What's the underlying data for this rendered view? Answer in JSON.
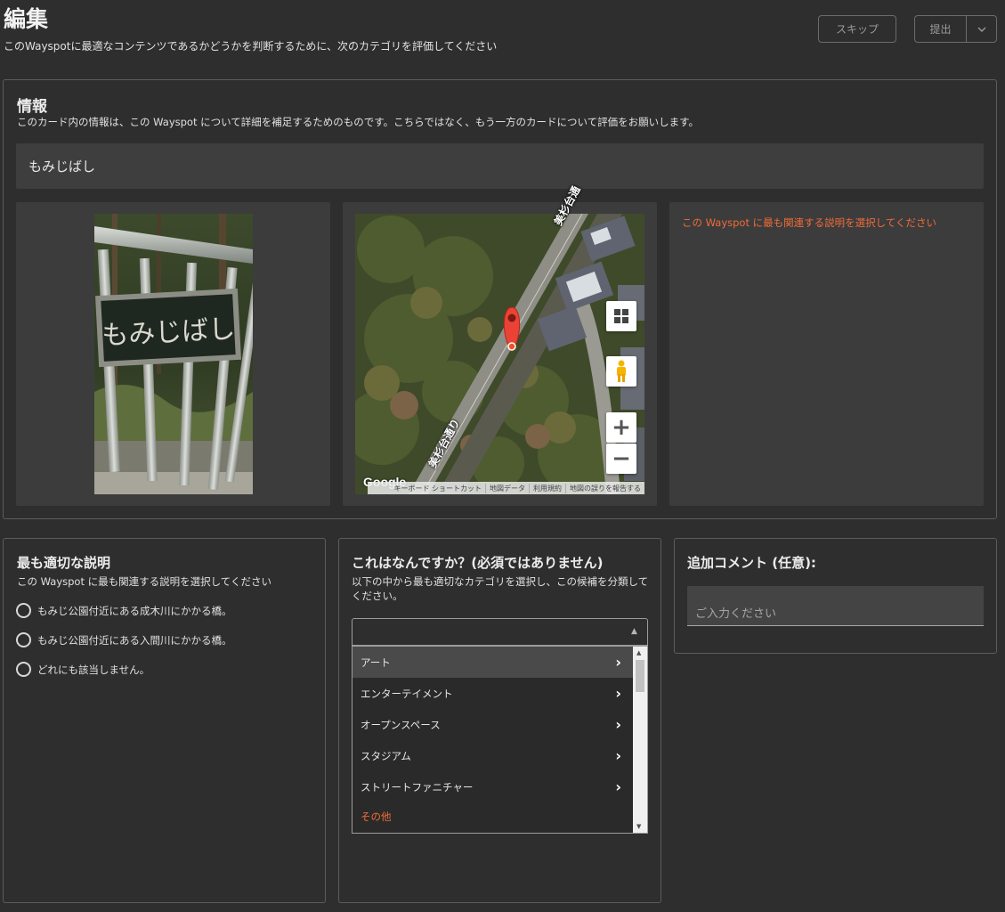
{
  "header": {
    "title": "編集",
    "subtitle": "このWayspotに最適なコンテンツであるかどうかを判断するために、次のカテゴリを評価してください",
    "skip_label": "スキップ",
    "submit_label": "提出",
    "submit_menu_icon": "chevron-down-icon"
  },
  "info": {
    "title": "情報",
    "description": "このカード内の情報は、この Wayspot について詳細を補足するためのものです。こちらではなく、もう一方のカードについて評価をお願いします。",
    "wayspot_title": "もみじばし",
    "photo_sign_text": "もみじばし",
    "description_hint": "この Wayspot に最も関連する説明を選択してください"
  },
  "map": {
    "road_label_top": "美杉台通",
    "road_label_bottom": "美杉台通り",
    "logo": "Google",
    "attribution": [
      "キーボード ショートカット",
      "地図データ",
      "利用規約",
      "地図の誤りを報告する"
    ],
    "controls": [
      "map-type-icon",
      "pegman-icon",
      "zoom-in-icon",
      "zoom-out-icon"
    ],
    "zoom_in_glyph": "+",
    "zoom_out_glyph": "−",
    "marker_color": "#ea4335"
  },
  "best_description": {
    "title": "最も適切な説明",
    "subtitle": "この Wayspot に最も関連する説明を選択してください",
    "options": [
      "もみじ公園付近にある成木川にかかる橋。",
      "もみじ公園付近にある入間川にかかる橋。",
      "どれにも該当しません。"
    ]
  },
  "what_is_it": {
    "title": "これはなんですか？(必須ではありません)",
    "description": "以下の中から最も適切なカテゴリを選択し、この候補を分類してください。",
    "select_value": "",
    "categories": [
      "アート",
      "エンターテイメント",
      "オープンスペース",
      "スタジアム",
      "ストリートファニチャー"
    ],
    "other_label": "その他"
  },
  "comment": {
    "title": "追加コメント (任意):",
    "placeholder": "ご入力ください"
  },
  "colors": {
    "background": "#2e2e2e",
    "panel": "#3c3c3c",
    "accent": "#ef6b3a"
  }
}
